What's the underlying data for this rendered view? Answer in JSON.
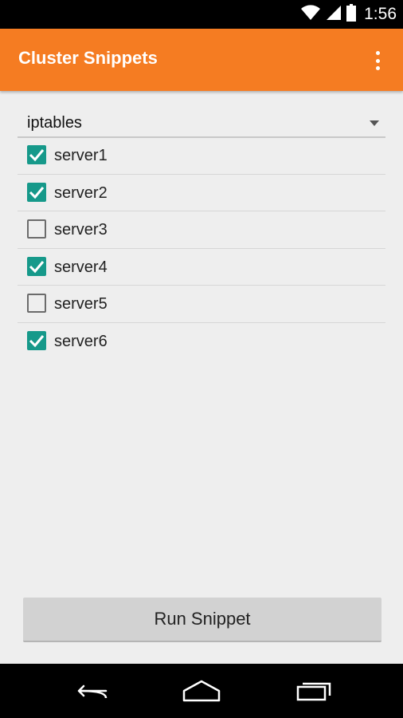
{
  "status_bar": {
    "time": "1:56",
    "icons": [
      "wifi-icon",
      "signal-icon",
      "battery-icon"
    ]
  },
  "app_bar": {
    "title": "Cluster Snippets",
    "overflow_icon": "more-vert-icon",
    "color": "#f57c22"
  },
  "snippet_spinner": {
    "selected": "iptables"
  },
  "servers": [
    {
      "label": "server1",
      "checked": true
    },
    {
      "label": "server2",
      "checked": true
    },
    {
      "label": "server3",
      "checked": false
    },
    {
      "label": "server4",
      "checked": true
    },
    {
      "label": "server5",
      "checked": false
    },
    {
      "label": "server6",
      "checked": true
    }
  ],
  "run_button": {
    "label": "Run Snippet"
  },
  "nav_bar": {
    "icons": [
      "back-icon",
      "home-icon",
      "recents-icon"
    ]
  },
  "colors": {
    "accent": "#16998a",
    "background": "#eeeeee"
  }
}
